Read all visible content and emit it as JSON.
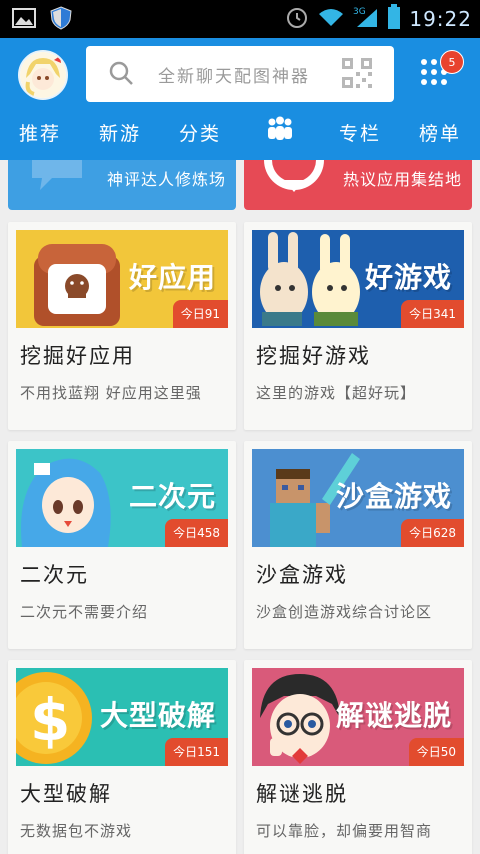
{
  "status_bar": {
    "time": "19:22",
    "network_label": "3G"
  },
  "header": {
    "search_placeholder": "全新聊天配图神器",
    "notification_count": "5"
  },
  "tabs": [
    {
      "label": "推荐"
    },
    {
      "label": "新游"
    },
    {
      "label": "分类"
    },
    {
      "label": "",
      "icon": "people-icon"
    },
    {
      "label": "专栏"
    },
    {
      "label": "榜单"
    }
  ],
  "banners": [
    {
      "text": "神评达人修炼场",
      "color": "#3e9fe3"
    },
    {
      "text": "热议应用集结地",
      "color": "#e64a55"
    }
  ],
  "cards": [
    {
      "title": "挖掘好应用",
      "desc": "不用找蓝翔 好应用这里强",
      "image_label": "好应用",
      "today": "今日91",
      "bg": "#f2c63a"
    },
    {
      "title": "挖掘好游戏",
      "desc": "这里的游戏【超好玩】",
      "image_label": "好游戏",
      "today": "今日341",
      "bg": "#1e5fae"
    },
    {
      "title": "二次元",
      "desc": "二次元不需要介绍",
      "image_label": "二次元",
      "today": "今日458",
      "bg": "#3cc4c8"
    },
    {
      "title": "沙盒游戏",
      "desc": "沙盒创造游戏综合讨论区",
      "image_label": "沙盒游戏",
      "today": "今日628",
      "bg": "#4c8fd0"
    },
    {
      "title": "大型破解",
      "desc": "无数据包不游戏",
      "image_label": "大型破解",
      "today": "今日151",
      "bg": "#2bbfb3"
    },
    {
      "title": "解谜逃脱",
      "desc": "可以靠脸，却偏要用智商",
      "image_label": "解谜逃脱",
      "today": "今日50",
      "bg": "#d95a7a"
    }
  ]
}
